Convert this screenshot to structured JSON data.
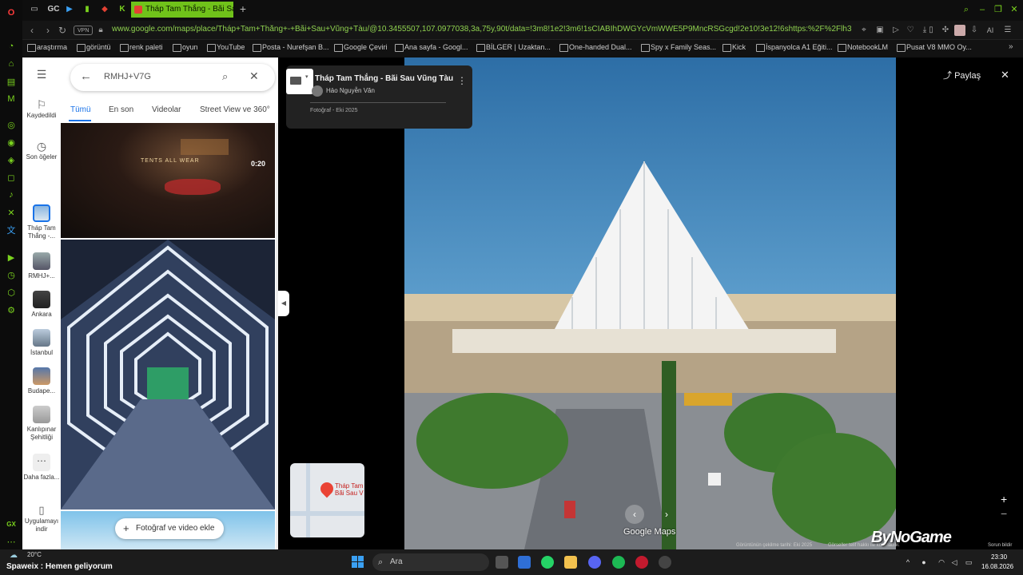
{
  "browser": {
    "active_tab_title": "Tháp Tam Thắng - Bãi Sau",
    "tab_icons": [
      "GC"
    ],
    "url": "www.google.com/maps/place/Tháp+Tam+Thắng+-+Bãi+Sau+Vũng+Tàu/@10.3455507,107.0977038,3a,75y,90t/data=!3m8!1e2!3m6!1sCIABIhDWGYcVmWWE5P9MncRSGcgd!2e10!3e12!6shttps:%2F%2Flh3.googleuserconten",
    "vpn_label": "VPN",
    "ai_label": "AI"
  },
  "bookmarks": [
    "araştırma",
    "görüntü",
    "renk paleti",
    "oyun",
    "YouTube",
    "Posta - Nurefşan B...",
    "Google Çeviri",
    "Ana sayfa - Googl...",
    "BİLGER | Uzaktan...",
    "One-handed Dual...",
    "Spy x Family Seas...",
    "Kick",
    "İspanyolca A1 Eğiti...",
    "NotebookLM",
    "Pusat V8 MMO Oy..."
  ],
  "maps_nav": {
    "saved": "Kaydedildi",
    "recent": "Son öğeler",
    "items": [
      "Tháp Tam Thắng -...",
      "RMHJ+...",
      "Ankara",
      "İstanbul",
      "Budape...",
      "Kanlıpınar Şehitliği"
    ],
    "more": "Daha fazla...",
    "app": "Uygulamayı indir"
  },
  "maps_panel": {
    "search_value": "RMHJ+V7G",
    "filters": [
      "Tümü",
      "En son",
      "Videolar",
      "Street View ve 360°"
    ],
    "video_duration": "0:20",
    "video_overlay_text": "TENTS ALL WEAR",
    "add_photo_label": "Fotoğraf ve video ekle"
  },
  "viewer": {
    "title": "Tháp Tam Thắng - Bãi Sau Vũng Tàu",
    "author": "Hảo Nguyễn Văn",
    "date": "Fotoğraf - Eki 2025",
    "share": "Paylaş",
    "minimap_label_line1": "Tháp Tam",
    "minimap_label_line2": "Bãi Sau V",
    "logo": "Google Maps",
    "footer_capture": "Görüntünün çekilme tarihi: Eki 2025",
    "footer_rights": "Görseller telif hakkı ile korunabilir.",
    "footer_report": "Sorun bildir",
    "watermark": "ByNoGame"
  },
  "taskbar": {
    "temp": "20°C",
    "weather": "Spaweix : Hemen geliyorum",
    "search": "Ara",
    "time": "23:30",
    "date": "16.08.2026"
  }
}
